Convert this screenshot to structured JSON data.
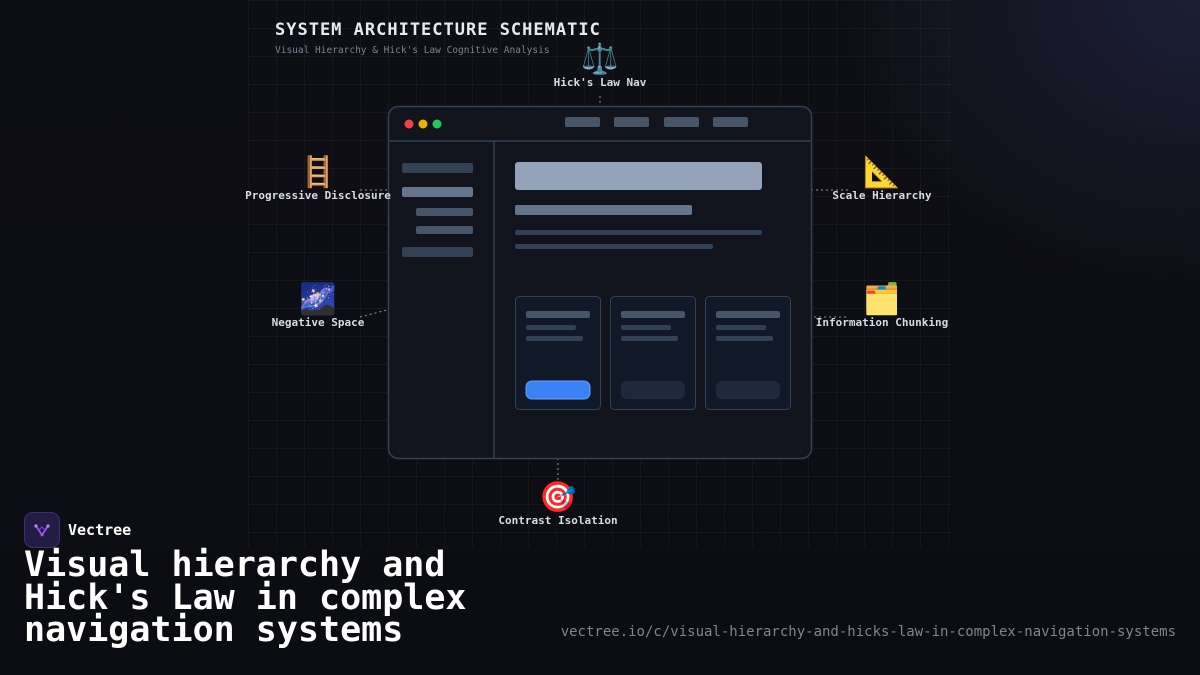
{
  "schematic": {
    "title": "SYSTEM ARCHITECTURE SCHEMATIC",
    "subtitle": "Visual Hierarchy & Hick's Law Cognitive Analysis"
  },
  "callouts": {
    "hicks_law_nav": {
      "icon": "⚖️",
      "icon_name": "scales-icon",
      "label": "Hick's Law Nav"
    },
    "progressive_disclosure": {
      "icon": "🪜",
      "icon_name": "ladder-icon",
      "label": "Progressive Disclosure"
    },
    "scale_hierarchy": {
      "icon": "📐",
      "icon_name": "triangle-ruler-icon",
      "label": "Scale Hierarchy"
    },
    "negative_space": {
      "icon": "🌌",
      "icon_name": "milky-way-icon",
      "label": "Negative Space"
    },
    "information_chunking": {
      "icon": "🗂️",
      "icon_name": "card-index-dividers-icon",
      "label": "Information Chunking"
    },
    "contrast_isolation": {
      "icon": "🎯",
      "icon_name": "target-icon",
      "label": "Contrast Isolation"
    }
  },
  "colors": {
    "window_dot_red": "#ef4444",
    "window_dot_yellow": "#eab308",
    "window_dot_green": "#22c55e",
    "primary_button": "#3b82f6",
    "hero_block": "#94a3b8",
    "frame_border": "#334155"
  },
  "brand": {
    "name": "Vectree",
    "logo_icon": "vectree-logo-icon"
  },
  "headline": "Visual hierarchy and Hick's Law in complex navigation systems",
  "url": "vectree.io/c/visual-hierarchy-and-hicks-law-in-complex-navigation-systems"
}
